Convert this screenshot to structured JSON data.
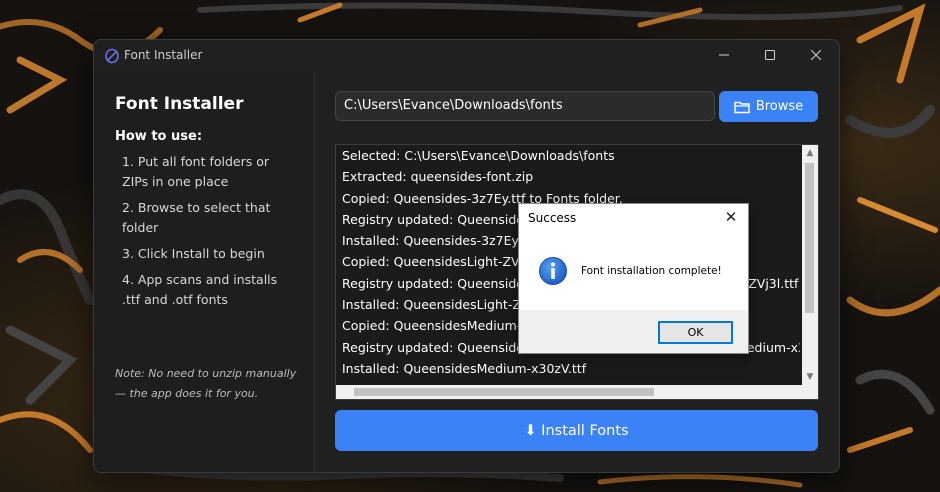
{
  "window": {
    "title": "Font Installer",
    "accent_color": "#3b82f6"
  },
  "sidebar": {
    "title": "Font Installer",
    "howto_heading": "How to use:",
    "steps": [
      "1.  Put all font folders or ZIPs in one place",
      "2.  Browse to select that folder",
      "3.  Click Install to begin",
      "4.  App scans and installs .ttf and .otf fonts"
    ],
    "note": "Note: No need to unzip manually — the app does it for you."
  },
  "path_field": {
    "value": "C:\\Users\\Evance\\Downloads\\fonts"
  },
  "browse_button": {
    "label": "Browse",
    "icon": "folder-icon"
  },
  "log": {
    "lines": [
      "Selected: C:\\Users\\Evance\\Downloads\\fonts",
      "Extracted: queensides-font.zip",
      "Copied: Queensides-3z7Ey.ttf to Fonts folder.",
      "Registry updated: Queensides-3z7Ey.ttf",
      "Installed: Queensides-3z7Ey.ttf",
      "Copied: QueensidesLight-ZVj3l.ttf to Fonts folder.",
      "Registry updated: QueensidesLight-ZVj3l.ttf -> QueensidesLight-ZVj3l.ttf",
      "Installed: QueensidesLight-ZVj3l.ttf",
      "Copied: QueensidesMedium-x30zV.ttf to Fonts folder.",
      "Registry updated: QueensidesMedium-x30zV.ttf -> QueensidesMedium-x30zV.ttf",
      "Installed: QueensidesMedium-x30zV.ttf"
    ]
  },
  "install_button": {
    "label": "⬇ Install Fonts"
  },
  "dialog": {
    "title": "Success",
    "message": "Font installation complete!",
    "ok_label": "OK",
    "icon": "info-icon"
  }
}
